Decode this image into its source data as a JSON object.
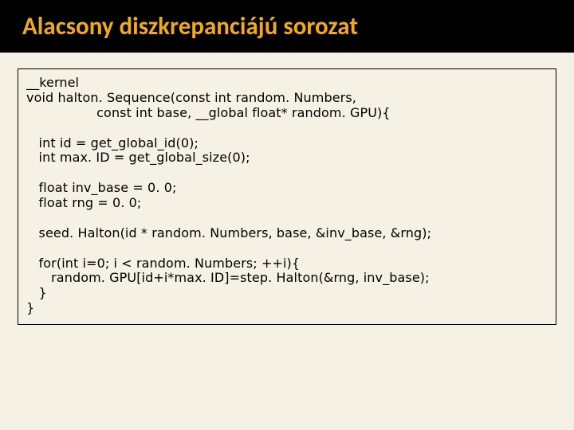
{
  "slide": {
    "title": "Alacsony diszkrepanciájú sorozat",
    "code": "__kernel\nvoid halton. Sequence(const int random. Numbers,\n                 const int base, __global float* random. GPU){\n\n   int id = get_global_id(0);\n   int max. ID = get_global_size(0);\n\n   float inv_base = 0. 0;\n   float rng = 0. 0;\n\n   seed. Halton(id * random. Numbers, base, &inv_base, &rng);\n\n   for(int i=0; i < random. Numbers; ++i){\n      random. GPU[id+i*max. ID]=step. Halton(&rng, inv_base);\n   }\n}"
  }
}
